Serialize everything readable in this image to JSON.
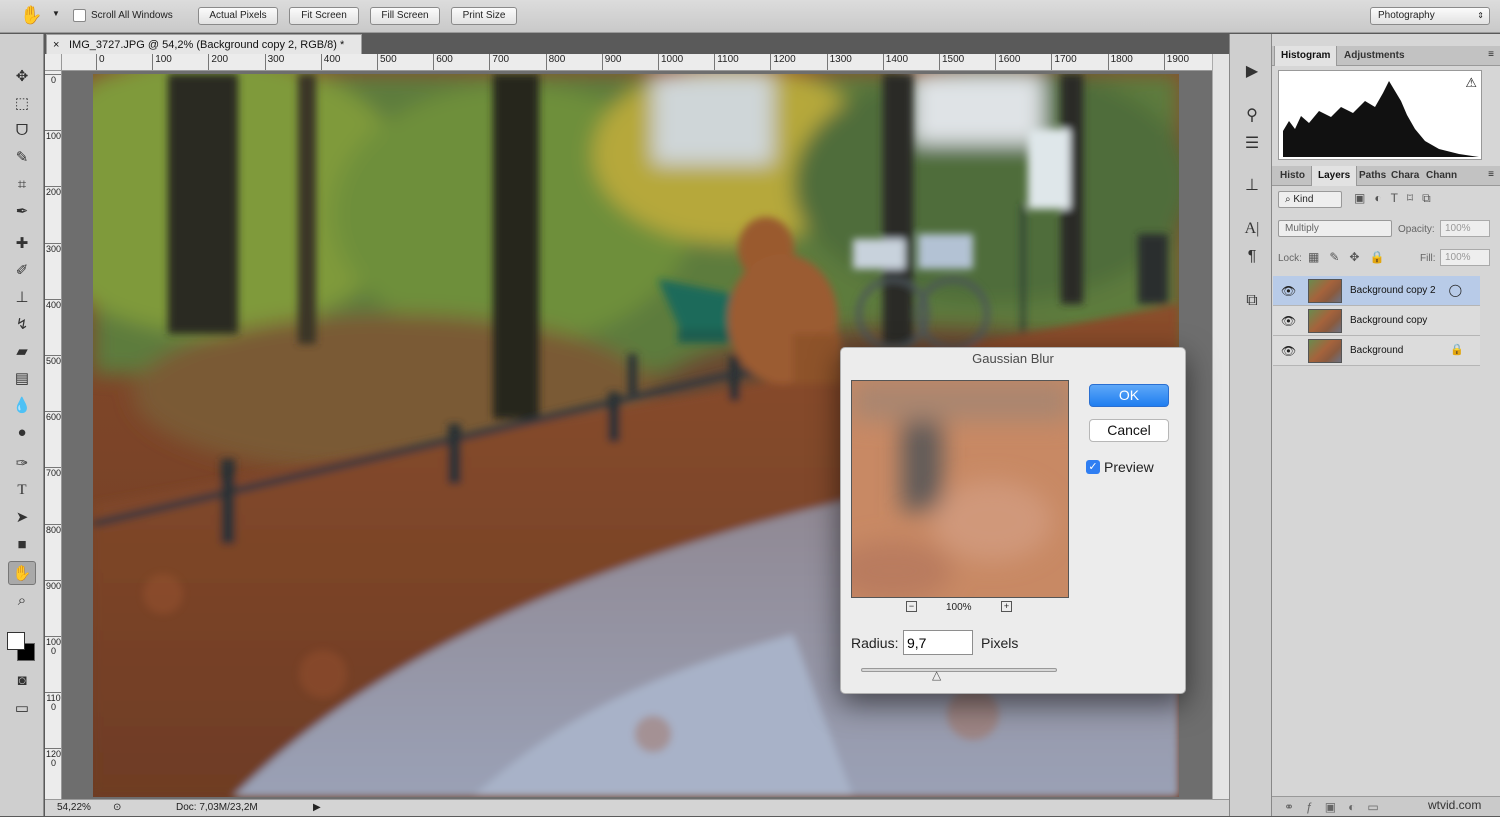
{
  "options_bar": {
    "scroll_all_windows": "Scroll All Windows",
    "buttons": [
      "Actual Pixels",
      "Fit Screen",
      "Fill Screen",
      "Print Size"
    ],
    "workspace": "Photography"
  },
  "document": {
    "tab_title": "IMG_3727.JPG @ 54,2% (Background copy 2, RGB/8) *",
    "ruler_top": [
      "0",
      "100",
      "200",
      "300",
      "400",
      "500",
      "600",
      "700",
      "800",
      "900",
      "1000",
      "1100",
      "1200",
      "1300",
      "1400",
      "1500",
      "1600",
      "1700",
      "1800",
      "1900"
    ],
    "ruler_left": [
      "0",
      "100",
      "200",
      "300",
      "400",
      "500",
      "600",
      "700",
      "800",
      "900",
      "1000",
      "1100",
      "1200"
    ],
    "zoom": "54,22%",
    "doc_size": "Doc: 7,03M/23,2M"
  },
  "dialog": {
    "title": "Gaussian Blur",
    "ok": "OK",
    "cancel": "Cancel",
    "preview_label": "Preview",
    "preview_checked": true,
    "zoom_level": "100%",
    "radius_label": "Radius:",
    "radius_value": "9,7",
    "radius_unit": "Pixels"
  },
  "panels": {
    "top_tabs": [
      "Histogram",
      "Adjustments"
    ],
    "layer_tabs": [
      "Histo",
      "Layers",
      "Paths",
      "Chara",
      "Chann"
    ],
    "kind_label": "Kind",
    "blend_mode": "Multiply",
    "opacity_label": "Opacity:",
    "opacity_value": "100%",
    "lock_label": "Lock:",
    "fill_label": "Fill:",
    "fill_value": "100%",
    "layers": [
      {
        "name": "Background copy 2",
        "selected": true
      },
      {
        "name": "Background copy",
        "selected": false
      },
      {
        "name": "Background",
        "selected": false,
        "locked": true
      }
    ]
  },
  "watermark": "wtvid.com",
  "icons": {
    "hand": "hand-icon",
    "move": "move-icon",
    "marquee": "marquee-icon",
    "lasso": "lasso-icon",
    "eye": "eye-icon",
    "lock": "lock-icon",
    "warning": "warning-icon"
  }
}
